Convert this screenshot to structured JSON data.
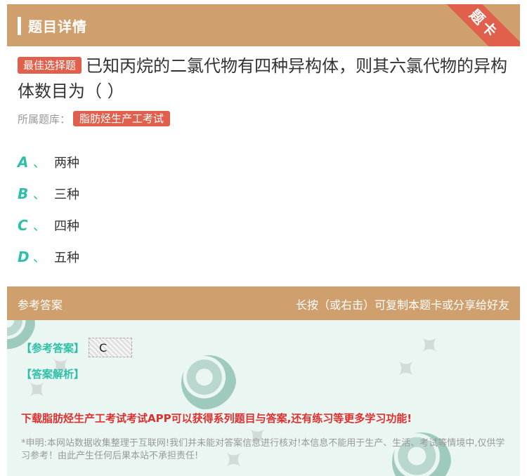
{
  "header": {
    "title": "题目详情",
    "ribbon": "题卡"
  },
  "question": {
    "type_tag": "最佳选择题",
    "text": "已知丙烷的二氯代物有四种异构体，则其六氯代物的异构体数目为（ ）",
    "source_label": "所属题库：",
    "source_tag": "脂肪烃生产工考试"
  },
  "options": [
    {
      "letter": "A",
      "sep": "、",
      "text": "两种"
    },
    {
      "letter": "B",
      "sep": "、",
      "text": "三种"
    },
    {
      "letter": "C",
      "sep": "、",
      "text": "四种"
    },
    {
      "letter": "D",
      "sep": "、",
      "text": "五种"
    }
  ],
  "answer_section": {
    "title": "参考答案",
    "hint": "长按（或右击）可复制本题卡或分享给好友",
    "answer_label": "【参考答案】",
    "answer_value": "C",
    "analysis_label": "【答案解析】",
    "promo": "下载脂肪烃生产工考试考试APP可以获得系列题目与答案,还有练习等更多学习功能!",
    "disclaimer": "*申明:本网站数据收集整理于互联网!我们并未能对答案信息进行核对!本信息不能用于生产、生活、考试等情境中,仅供学习参考！由此产生任何后果本站不承担责任!"
  },
  "colors": {
    "header": "#cfa06e",
    "accent_red": "#e0604d",
    "accent_teal": "#2ebfa8",
    "promo_red": "#e02f2f"
  }
}
